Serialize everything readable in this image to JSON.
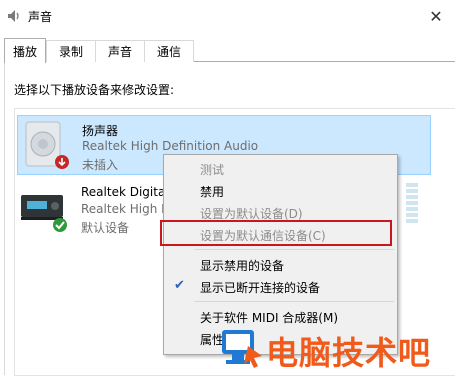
{
  "window": {
    "title": "声音",
    "close_glyph": "✕"
  },
  "tabs": [
    {
      "label": "播放",
      "active": true
    },
    {
      "label": "录制"
    },
    {
      "label": "声音"
    },
    {
      "label": "通信"
    }
  ],
  "instruction": "选择以下播放设备来修改设置:",
  "devices": [
    {
      "name": "扬声器",
      "description": "Realtek High Definition Audio",
      "status": "未插入",
      "icon": "speaker-icon",
      "badge": "unplugged-down-arrow-badge",
      "selected": true
    },
    {
      "name": "Realtek Digital",
      "description": "Realtek High D",
      "status": "默认设备",
      "icon": "digital-receiver-icon",
      "badge": "default-check-badge"
    }
  ],
  "context_menu": {
    "items": [
      {
        "label": "测试",
        "enabled": false
      },
      {
        "label": "禁用",
        "enabled": true
      },
      {
        "label": "设置为默认设备(D)",
        "enabled": false
      },
      {
        "label": "设置为默认通信设备(C)",
        "enabled": false,
        "highlighted": true
      },
      {
        "label": "显示禁用的设备",
        "enabled": true
      },
      {
        "label": "显示已断开连接的设备",
        "enabled": true,
        "checked": true
      },
      {
        "label": "关于软件 MIDI 合成器(M)",
        "enabled": true
      },
      {
        "label": "属性",
        "enabled": true
      }
    ]
  },
  "watermark": {
    "text": "电脑技术吧"
  },
  "colors": {
    "selection": "#cce8ff",
    "highlight_box": "#c8171f",
    "watermark": "#f05a1a",
    "accent": "#2b61b6"
  }
}
